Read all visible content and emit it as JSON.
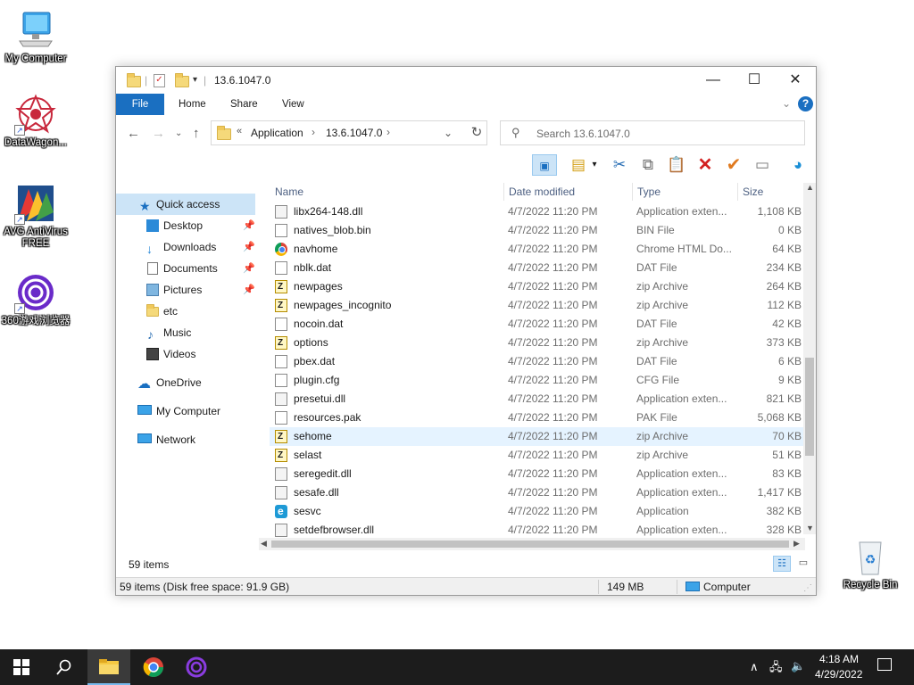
{
  "desktop": {
    "icons": [
      {
        "label": "My Computer"
      },
      {
        "label": "DataWagon..."
      },
      {
        "label": "AVG AntiVirus FREE"
      },
      {
        "label": "360游戏浏览器"
      },
      {
        "label": "Recycle Bin"
      }
    ]
  },
  "window": {
    "title": "13.6.1047.0",
    "ribbon_tabs": [
      "File",
      "Home",
      "Share",
      "View"
    ],
    "address": {
      "overflow": "«",
      "crumbs": [
        "Application",
        "13.6.1047.0"
      ]
    },
    "search": {
      "placeholder": "Search 13.6.1047.0"
    },
    "nav": {
      "items": [
        {
          "label": "Quick access"
        },
        {
          "label": "Desktop"
        },
        {
          "label": "Downloads"
        },
        {
          "label": "Documents"
        },
        {
          "label": "Pictures"
        },
        {
          "label": "etc"
        },
        {
          "label": "Music"
        },
        {
          "label": "Videos"
        },
        {
          "label": "OneDrive"
        },
        {
          "label": "My Computer"
        },
        {
          "label": "Network"
        }
      ]
    },
    "columns": {
      "name": "Name",
      "date": "Date modified",
      "type": "Type",
      "size": "Size"
    },
    "files": [
      {
        "name": "libx264-148.dll",
        "date": "4/7/2022 11:20 PM",
        "type": "Application exten...",
        "size": "1,108 KB",
        "icon": "dll-icon"
      },
      {
        "name": "natives_blob.bin",
        "date": "4/7/2022 11:20 PM",
        "type": "BIN File",
        "size": "0 KB",
        "icon": "file-icon"
      },
      {
        "name": "navhome",
        "date": "4/7/2022 11:20 PM",
        "type": "Chrome HTML Do...",
        "size": "64 KB",
        "icon": "chrome-icon"
      },
      {
        "name": "nblk.dat",
        "date": "4/7/2022 11:20 PM",
        "type": "DAT File",
        "size": "234 KB",
        "icon": "file-icon"
      },
      {
        "name": "newpages",
        "date": "4/7/2022 11:20 PM",
        "type": "zip Archive",
        "size": "264 KB",
        "icon": "zip-icon"
      },
      {
        "name": "newpages_incognito",
        "date": "4/7/2022 11:20 PM",
        "type": "zip Archive",
        "size": "112 KB",
        "icon": "zip-icon"
      },
      {
        "name": "nocoin.dat",
        "date": "4/7/2022 11:20 PM",
        "type": "DAT File",
        "size": "42 KB",
        "icon": "file-icon"
      },
      {
        "name": "options",
        "date": "4/7/2022 11:20 PM",
        "type": "zip Archive",
        "size": "373 KB",
        "icon": "zip-icon"
      },
      {
        "name": "pbex.dat",
        "date": "4/7/2022 11:20 PM",
        "type": "DAT File",
        "size": "6 KB",
        "icon": "file-icon"
      },
      {
        "name": "plugin.cfg",
        "date": "4/7/2022 11:20 PM",
        "type": "CFG File",
        "size": "9 KB",
        "icon": "file-icon"
      },
      {
        "name": "presetui.dll",
        "date": "4/7/2022 11:20 PM",
        "type": "Application exten...",
        "size": "821 KB",
        "icon": "dll-icon"
      },
      {
        "name": "resources.pak",
        "date": "4/7/2022 11:20 PM",
        "type": "PAK File",
        "size": "5,068 KB",
        "icon": "file-icon"
      },
      {
        "name": "sehome",
        "date": "4/7/2022 11:20 PM",
        "type": "zip Archive",
        "size": "70 KB",
        "icon": "zip-icon"
      },
      {
        "name": "selast",
        "date": "4/7/2022 11:20 PM",
        "type": "zip Archive",
        "size": "51 KB",
        "icon": "zip-icon"
      },
      {
        "name": "seregedit.dll",
        "date": "4/7/2022 11:20 PM",
        "type": "Application exten...",
        "size": "83 KB",
        "icon": "dll-icon"
      },
      {
        "name": "sesafe.dll",
        "date": "4/7/2022 11:20 PM",
        "type": "Application exten...",
        "size": "1,417 KB",
        "icon": "dll-icon"
      },
      {
        "name": "sesvc",
        "date": "4/7/2022 11:20 PM",
        "type": "Application",
        "size": "382 KB",
        "icon": "app-icon"
      },
      {
        "name": "setdefbrowser.dll",
        "date": "4/7/2022 11:20 PM",
        "type": "Application exten...",
        "size": "328 KB",
        "icon": "dll-icon"
      }
    ],
    "item_count": "59 items",
    "statusbar": {
      "left": "59 items (Disk free space: 91.9 GB)",
      "size": "149 MB",
      "location": "Computer"
    }
  },
  "taskbar": {
    "time": "4:18 AM",
    "date": "4/29/2022"
  },
  "colors": {
    "accent": "#1a6fc1",
    "selection": "#cce4f7",
    "hover": "#e5f3ff",
    "taskbar": "#1c1c1c"
  }
}
